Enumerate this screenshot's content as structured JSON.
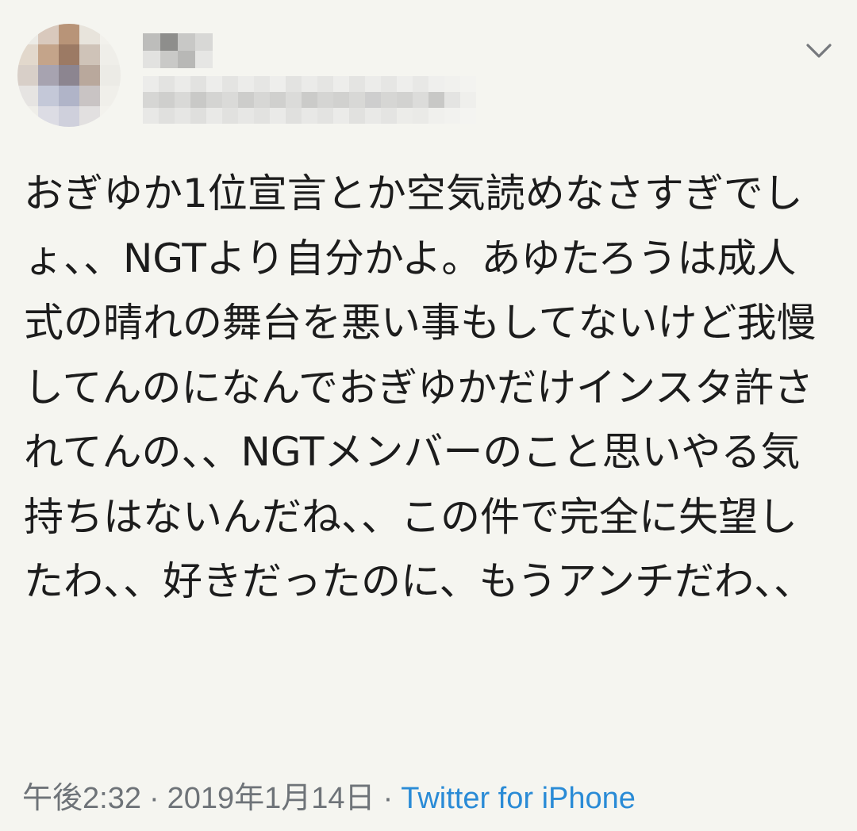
{
  "tweet": {
    "body": "おぎゆか1位宣言とか空気読めなさすぎでしょ、、NGTより自分かよ。あゆたろうは成人式の晴れの舞台を悪い事もしてないけど我慢してんのになんでおぎゆかだけインスタ許されてんの、、NGTメンバーのこと思いやる気持ちはないんだね、、この件で完全に失望したわ、、好きだったのに、もうアンチだわ、、",
    "time": "午後2:32",
    "separator": "·",
    "date": "2019年1月14日",
    "source": "Twitter for iPhone"
  },
  "icons": {
    "menu": "chevron-down-icon"
  },
  "colors": {
    "background": "#f5f5f0",
    "text": "#1c1c1c",
    "meta": "#6e7378",
    "link": "#2a8bd6"
  }
}
